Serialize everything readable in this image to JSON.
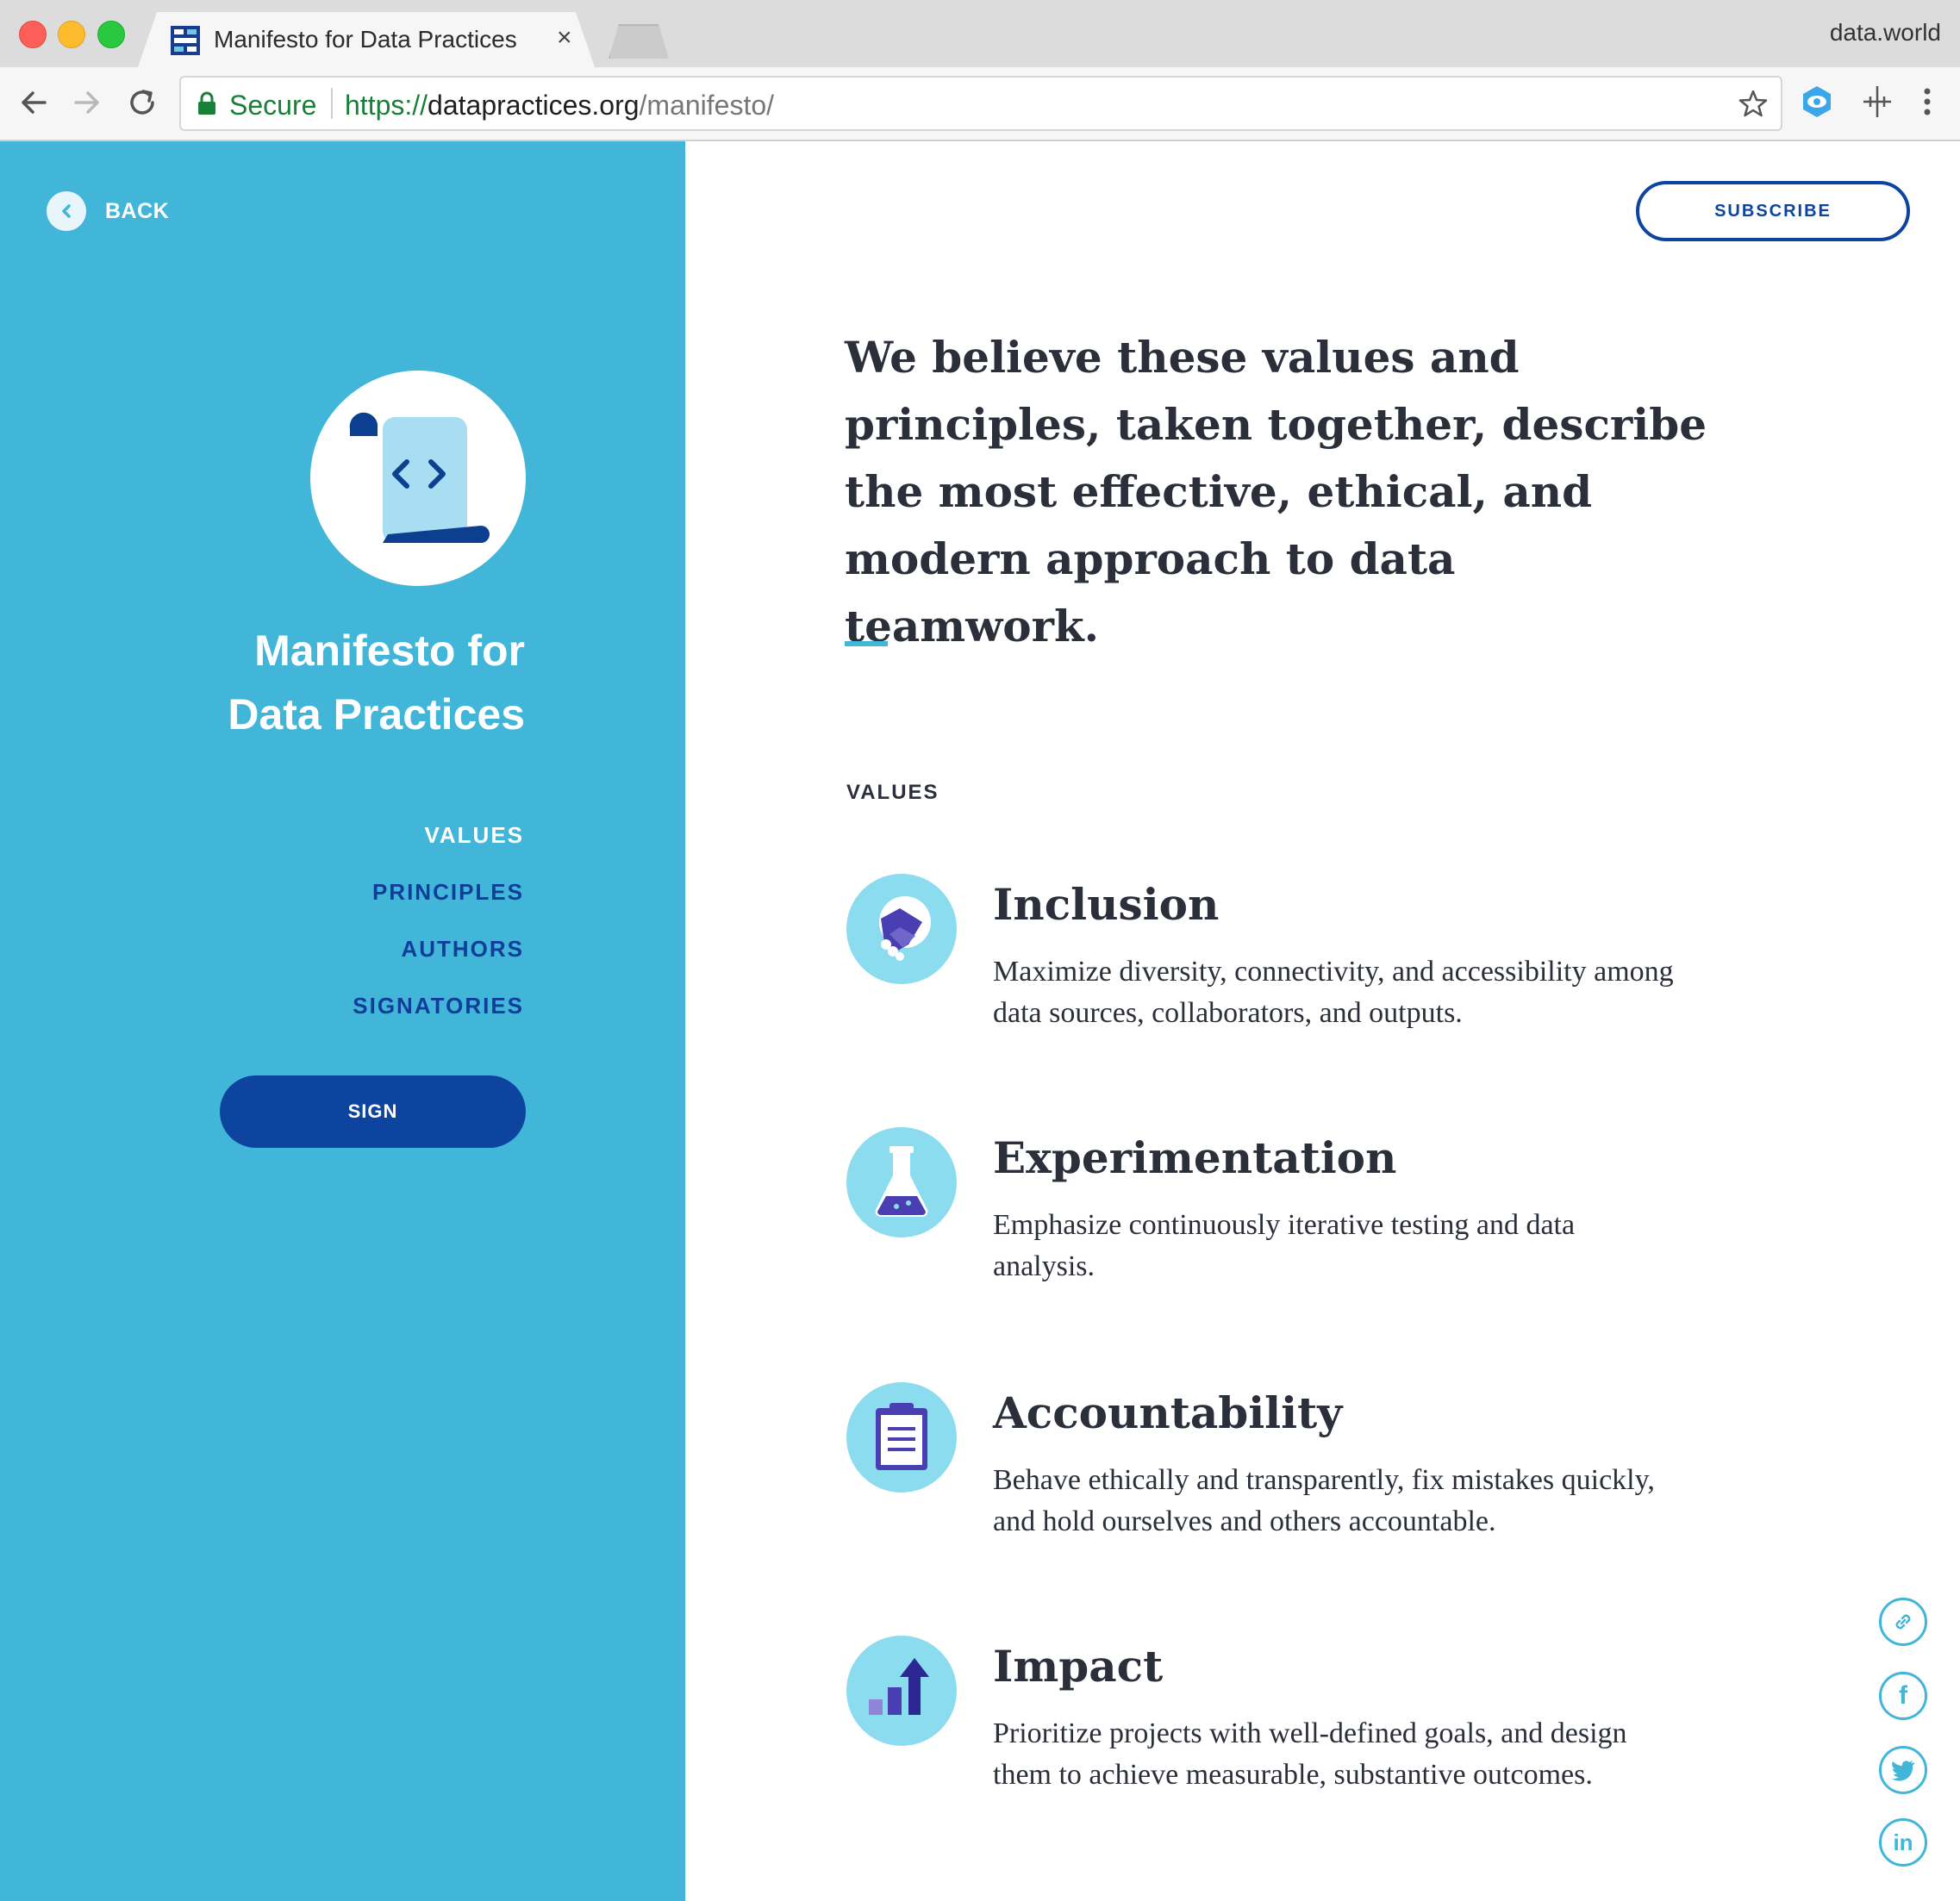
{
  "browser": {
    "tab_title": "Manifesto for Data Practices",
    "tab_close": "×",
    "profile_name": "data.world",
    "secure_label": "Secure",
    "url_scheme": "https://",
    "url_host": "datapractices.org",
    "url_path": "/manifesto/",
    "icons": [
      "back-arrow-icon",
      "forward-arrow-icon",
      "reload-icon",
      "lock-icon",
      "star-icon",
      "extension-eye-icon",
      "extension-crosshair-icon",
      "menu-kebab-icon"
    ]
  },
  "sidebar": {
    "back_label": "BACK",
    "title_line1": "Manifesto for",
    "title_line2": "Data Practices",
    "nav": [
      {
        "label": "VALUES",
        "active": true
      },
      {
        "label": "PRINCIPLES",
        "active": false
      },
      {
        "label": "AUTHORS",
        "active": false
      },
      {
        "label": "SIGNATORIES",
        "active": false
      }
    ],
    "sign_label": "SIGN",
    "background_color": "#42b6d8"
  },
  "main": {
    "subscribe_label": "SUBSCRIBE",
    "intro": "We believe these values and principles, taken together, describe the most effective, ethical, and modern approach to data teamwork.",
    "section_label": "VALUES",
    "values": [
      {
        "icon": "handshake-icon",
        "title": "Inclusion",
        "description": "Maximize diversity, connectivity, and accessibility among data sources, collaborators, and outputs."
      },
      {
        "icon": "flask-icon",
        "title": "Experimentation",
        "description": "Emphasize continuously iterative testing and data analysis."
      },
      {
        "icon": "clipboard-icon",
        "title": "Accountability",
        "description": "Behave ethically and transparently, fix mistakes quickly, and hold ourselves and others accountable."
      },
      {
        "icon": "bar-chart-arrow-icon",
        "title": "Impact",
        "description": "Prioritize projects with well-defined goals, and design them to achieve measurable, substantive outcomes."
      }
    ]
  },
  "share": [
    {
      "icon": "link-icon"
    },
    {
      "icon": "facebook-icon",
      "glyph": "f"
    },
    {
      "icon": "twitter-icon"
    },
    {
      "icon": "linkedin-icon",
      "glyph": "in"
    }
  ],
  "colors": {
    "accent": "#42b6d8",
    "brand_dark": "#0c44a0",
    "nav_inactive": "#0f3e9a",
    "icon_bg": "#8bdcef",
    "icon_fg": "#4a3fb2",
    "text": "#2a2f3a"
  }
}
